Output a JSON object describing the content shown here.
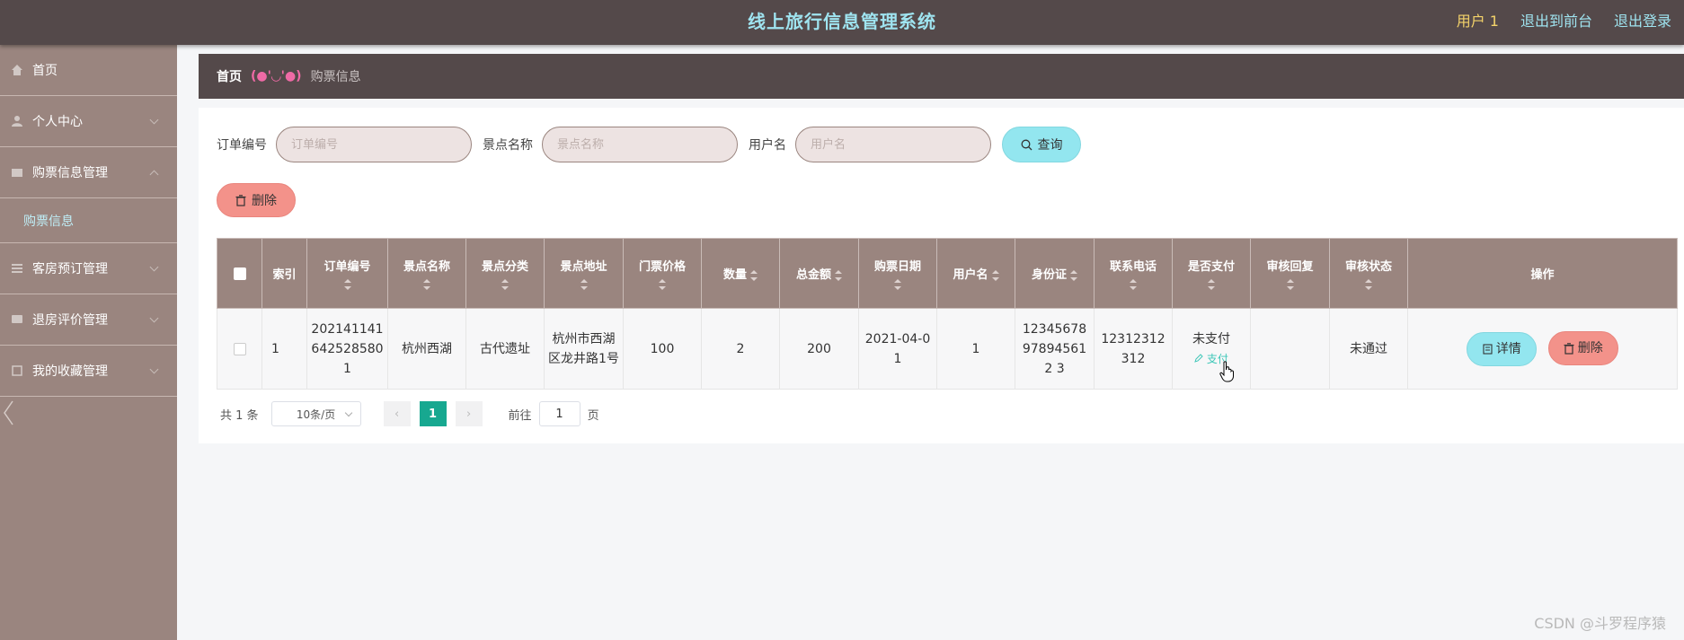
{
  "header": {
    "title": "线上旅行信息管理系统",
    "user": "用户 1",
    "back_to_front": "退出到前台",
    "logout": "退出登录"
  },
  "sidebar": {
    "items": [
      {
        "label": "首页",
        "icon": "home-icon"
      },
      {
        "label": "个人中心",
        "icon": "user-icon"
      },
      {
        "label": "购票信息管理",
        "icon": "ticket-icon"
      },
      {
        "label": "购票信息",
        "icon": ""
      },
      {
        "label": "客房预订管理",
        "icon": "list-icon"
      },
      {
        "label": "退房评价管理",
        "icon": "comment-icon"
      },
      {
        "label": "我的收藏管理",
        "icon": "star-icon"
      }
    ]
  },
  "breadcrumb": {
    "home": "首页",
    "sep": "(●'◡'●)",
    "current": "购票信息"
  },
  "search": {
    "order_label": "订单编号",
    "order_placeholder": "订单编号",
    "spot_label": "景点名称",
    "spot_placeholder": "景点名称",
    "user_label": "用户名",
    "user_placeholder": "用户名",
    "query_button": "查询"
  },
  "toolbar": {
    "delete_button": "删除"
  },
  "table": {
    "headers": [
      "索引",
      "订单编号",
      "景点名称",
      "景点分类",
      "景点地址",
      "门票价格",
      "数量",
      "总金额",
      "购票日期",
      "用户名",
      "身份证",
      "联系电话",
      "是否支付",
      "审核回复",
      "审核状态",
      "操作"
    ],
    "rows": [
      {
        "index": "1",
        "order_no": "2021411416425285801",
        "spot_name": "杭州西湖",
        "category": "古代遗址",
        "address": "杭州市西湖区龙井路1号",
        "price": "100",
        "qty": "2",
        "total": "200",
        "date": "2021-04-01",
        "username": "1",
        "id_card": "12345678978945612 3",
        "phone": "12312312312",
        "paid": "未支付",
        "pay_link": "支付",
        "reply": "",
        "status": "未通过",
        "detail_button": "详情",
        "delete_button": "删除"
      }
    ]
  },
  "pager": {
    "total": "共 1 条",
    "page_size": "10条/页",
    "current": "1",
    "goto_label": "前往",
    "goto_value": "1",
    "page_suffix": "页"
  },
  "watermark": "CSDN @斗罗程序猿",
  "colors": {
    "header_bg": "#54494a",
    "sidebar_bg": "#9a857f",
    "title": "#9fe4f0",
    "accent_cyan": "#93e6ef",
    "accent_red": "#f3928a",
    "pager_active": "#17a890"
  }
}
